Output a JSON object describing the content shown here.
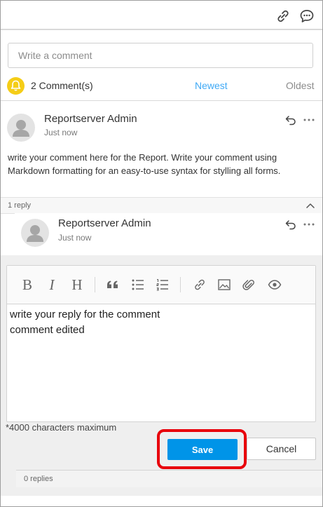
{
  "header": {
    "link_icon": "link-icon",
    "comments_icon": "comments-icon"
  },
  "comment_input": {
    "placeholder": "Write a comment"
  },
  "summary": {
    "count_label": "2 Comment(s)",
    "sort_newest": "Newest",
    "sort_oldest": "Oldest",
    "badge_color": "#f5cd17",
    "accent_color": "#3fa9f5"
  },
  "comment": {
    "author": "Reportserver Admin",
    "time": "Just now",
    "body": "write your comment here for the Report. Write your comment using Markdown formatting for an easy-to-use syntax for stylling all forms.",
    "reply_count": "1 reply"
  },
  "reply": {
    "author": "Reportserver Admin",
    "time": "Just now"
  },
  "editor": {
    "toolbar": [
      "B",
      "I",
      "H",
      "quote-icon",
      "bulleted-list-icon",
      "numbered-list-icon",
      "link-icon",
      "image-icon",
      "attachment-icon",
      "preview-icon"
    ],
    "content": "write your reply for the comment\ncomment edited",
    "char_limit": "*4000 characters maximum",
    "save_label": "Save",
    "cancel_label": "Cancel",
    "save_color": "#0094e8",
    "highlight_color": "#e8000b"
  },
  "reply_footer": {
    "replies_label": "0 replies"
  }
}
